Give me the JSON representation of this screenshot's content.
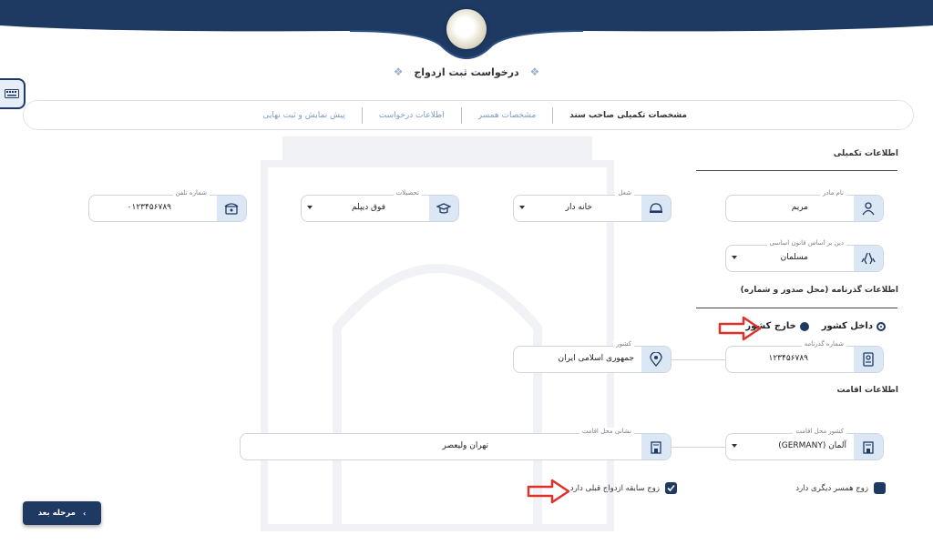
{
  "page": {
    "title": "درخواست ثبت ازدواج"
  },
  "steps": [
    {
      "label": "مشخصات تکمیلی صاحب سند",
      "active": true
    },
    {
      "label": "مشخصات همسر",
      "active": false
    },
    {
      "label": "اطلاعات درخواست",
      "active": false
    },
    {
      "label": "پیش نمایش و ثبت نهایی",
      "active": false
    }
  ],
  "sections": {
    "complementary": "اطلاعات تکمیلی",
    "passport": "اطلاعات گذرنامه (محل صدور و شماره)",
    "residence": "اطلاعات اقامت"
  },
  "fields": {
    "mother_name": {
      "label": "نام مادر",
      "value": "مریم"
    },
    "job": {
      "label": "شغل",
      "value": "خانه دار"
    },
    "education": {
      "label": "تحصیلات",
      "value": "فوق دیپلم"
    },
    "phone": {
      "label": "شماره تلفن",
      "value": "۰۱۲۳۴۵۶۷۸۹"
    },
    "religion": {
      "label": "دین بر اساس قانون اساسی",
      "value": "مسلمان"
    },
    "passport_number": {
      "label": "شماره گذرنامه",
      "value": "۱۲۳۴۵۶۷۸۹"
    },
    "country": {
      "label": "کشور",
      "value": "جمهوری اسلامی ایران"
    },
    "residence_country": {
      "label": "کشور محل اقامت",
      "value": "آلمان (GERMANY)"
    },
    "residence_address": {
      "label": "نشانی محل اقامت",
      "value": "تهران ولیعصر"
    }
  },
  "passport_issue": {
    "inside": "داخل کشور",
    "outside": "خارج کشور",
    "selected": "inside"
  },
  "checks": {
    "other_wife": {
      "label": "زوج همسر دیگری دارد",
      "checked": false
    },
    "prior_marriage": {
      "label": "زوج سابقه ازدواج قبلی دارد",
      "checked": true
    }
  },
  "buttons": {
    "next": "مرحله بعد"
  },
  "colors": {
    "primary": "#1e3a63",
    "icon_bg": "#dbe7f4",
    "annotation": "#e0302a"
  },
  "icons": {
    "keyboard": "keyboard-icon",
    "person": "person-icon",
    "helmet": "helmet-icon",
    "graduation": "graduation-icon",
    "phone": "phone-icon",
    "praying_hands": "praying-hands-icon",
    "passport": "passport-icon",
    "location": "location-icon",
    "building": "building-icon"
  }
}
